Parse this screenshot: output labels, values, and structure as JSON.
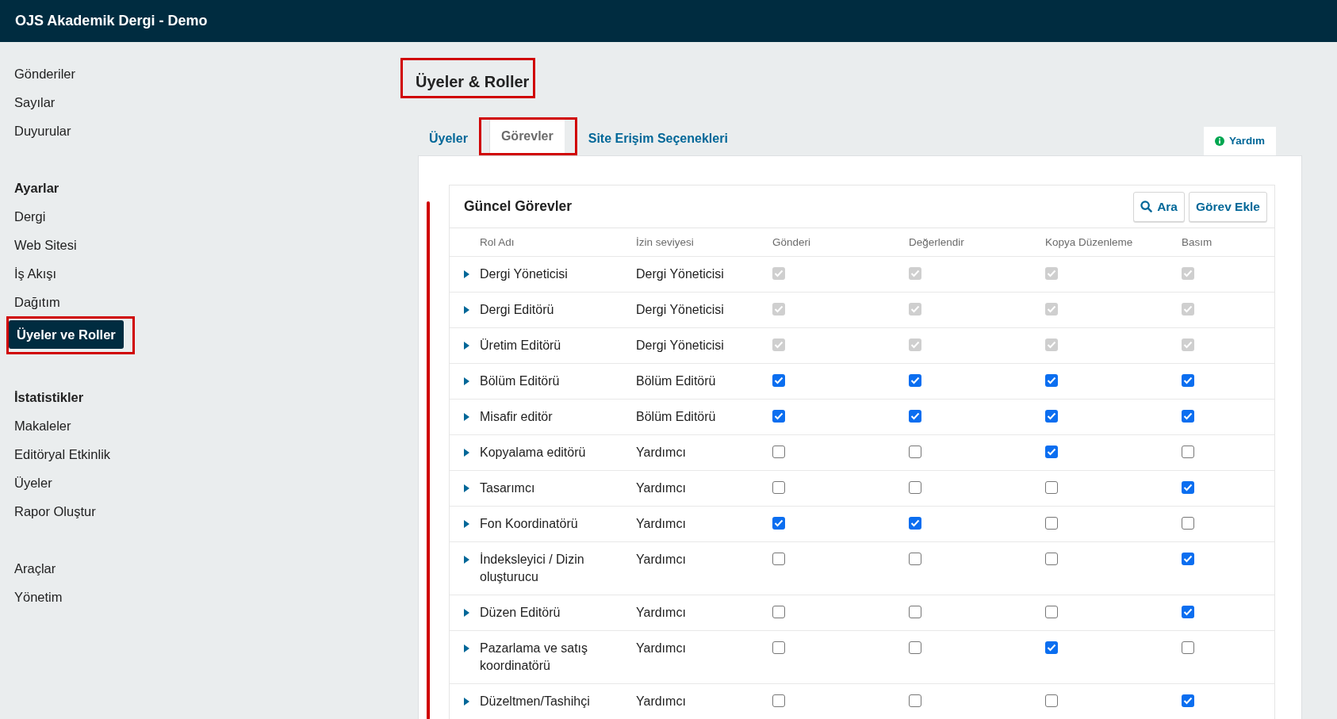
{
  "header": {
    "title": "OJS Akademik Dergi - Demo"
  },
  "sidebar": {
    "groups": [
      {
        "items": [
          {
            "label": "Gönderiler",
            "selected": false,
            "highlighted": false
          },
          {
            "label": "Sayılar",
            "selected": false,
            "highlighted": false
          },
          {
            "label": "Duyurular",
            "selected": false,
            "highlighted": false
          }
        ]
      },
      {
        "heading": "Ayarlar",
        "items": [
          {
            "label": "Dergi",
            "selected": false,
            "highlighted": false
          },
          {
            "label": "Web Sitesi",
            "selected": false,
            "highlighted": false
          },
          {
            "label": "İş Akışı",
            "selected": false,
            "highlighted": false
          },
          {
            "label": "Dağıtım",
            "selected": false,
            "highlighted": false
          },
          {
            "label": "Üyeler ve Roller",
            "selected": true,
            "highlighted": true
          }
        ]
      },
      {
        "heading": "İstatistikler",
        "items": [
          {
            "label": "Makaleler",
            "selected": false,
            "highlighted": false
          },
          {
            "label": "Editöryal Etkinlik",
            "selected": false,
            "highlighted": false
          },
          {
            "label": "Üyeler",
            "selected": false,
            "highlighted": false
          },
          {
            "label": "Rapor Oluştur",
            "selected": false,
            "highlighted": false
          }
        ]
      },
      {
        "items": [
          {
            "label": "Araçlar",
            "selected": false,
            "highlighted": false
          },
          {
            "label": "Yönetim",
            "selected": false,
            "highlighted": false
          }
        ]
      }
    ]
  },
  "page": {
    "title": "Üyeler & Roller",
    "title_highlighted": true,
    "annotation_bar": true
  },
  "tabs": [
    {
      "label": "Üyeler",
      "selected": false,
      "highlighted": false
    },
    {
      "label": "Görevler",
      "selected": true,
      "highlighted": true
    },
    {
      "label": "Site Erişim Seçenekleri",
      "selected": false,
      "highlighted": false
    }
  ],
  "help_button": "Yardım",
  "grid": {
    "title": "Güncel Görevler",
    "actions": [
      {
        "label": "Ara",
        "kind": "search"
      },
      {
        "label": "Görev Ekle",
        "kind": "plain"
      }
    ],
    "columns": [
      "Rol Adı",
      "İzin seviyesi",
      "Gönderi",
      "Değerlendir",
      "Kopya Düzenleme",
      "Basım"
    ],
    "rows": [
      {
        "name": "Dergi Yöneticisi",
        "level": "Dergi Yöneticisi",
        "stages": [
          {
            "checked": true,
            "disabled": true
          },
          {
            "checked": true,
            "disabled": true
          },
          {
            "checked": true,
            "disabled": true
          },
          {
            "checked": true,
            "disabled": true
          }
        ]
      },
      {
        "name": "Dergi Editörü",
        "level": "Dergi Yöneticisi",
        "stages": [
          {
            "checked": true,
            "disabled": true
          },
          {
            "checked": true,
            "disabled": true
          },
          {
            "checked": true,
            "disabled": true
          },
          {
            "checked": true,
            "disabled": true
          }
        ]
      },
      {
        "name": "Üretim Editörü",
        "level": "Dergi Yöneticisi",
        "stages": [
          {
            "checked": true,
            "disabled": true
          },
          {
            "checked": true,
            "disabled": true
          },
          {
            "checked": true,
            "disabled": true
          },
          {
            "checked": true,
            "disabled": true
          }
        ]
      },
      {
        "name": "Bölüm Editörü",
        "level": "Bölüm Editörü",
        "stages": [
          {
            "checked": true,
            "disabled": false
          },
          {
            "checked": true,
            "disabled": false
          },
          {
            "checked": true,
            "disabled": false
          },
          {
            "checked": true,
            "disabled": false
          }
        ]
      },
      {
        "name": "Misafir editör",
        "level": "Bölüm Editörü",
        "stages": [
          {
            "checked": true,
            "disabled": false
          },
          {
            "checked": true,
            "disabled": false
          },
          {
            "checked": true,
            "disabled": false
          },
          {
            "checked": true,
            "disabled": false
          }
        ]
      },
      {
        "name": "Kopyalama editörü",
        "level": "Yardımcı",
        "stages": [
          {
            "checked": false,
            "disabled": false
          },
          {
            "checked": false,
            "disabled": false
          },
          {
            "checked": true,
            "disabled": false
          },
          {
            "checked": false,
            "disabled": false
          }
        ]
      },
      {
        "name": "Tasarımcı",
        "level": "Yardımcı",
        "stages": [
          {
            "checked": false,
            "disabled": false
          },
          {
            "checked": false,
            "disabled": false
          },
          {
            "checked": false,
            "disabled": false
          },
          {
            "checked": true,
            "disabled": false
          }
        ]
      },
      {
        "name": "Fon Koordinatörü",
        "level": "Yardımcı",
        "stages": [
          {
            "checked": true,
            "disabled": false
          },
          {
            "checked": true,
            "disabled": false
          },
          {
            "checked": false,
            "disabled": false
          },
          {
            "checked": false,
            "disabled": false
          }
        ]
      },
      {
        "name": "İndeksleyici / Dizin oluşturucu",
        "level": "Yardımcı",
        "stages": [
          {
            "checked": false,
            "disabled": false
          },
          {
            "checked": false,
            "disabled": false
          },
          {
            "checked": false,
            "disabled": false
          },
          {
            "checked": true,
            "disabled": false
          }
        ]
      },
      {
        "name": "Düzen Editörü",
        "level": "Yardımcı",
        "stages": [
          {
            "checked": false,
            "disabled": false
          },
          {
            "checked": false,
            "disabled": false
          },
          {
            "checked": false,
            "disabled": false
          },
          {
            "checked": true,
            "disabled": false
          }
        ]
      },
      {
        "name": "Pazarlama ve satış koordinatörü",
        "level": "Yardımcı",
        "stages": [
          {
            "checked": false,
            "disabled": false
          },
          {
            "checked": false,
            "disabled": false
          },
          {
            "checked": true,
            "disabled": false
          },
          {
            "checked": false,
            "disabled": false
          }
        ]
      },
      {
        "name": "Düzeltmen/Tashihçi",
        "level": "Yardımcı",
        "stages": [
          {
            "checked": false,
            "disabled": false
          },
          {
            "checked": false,
            "disabled": false
          },
          {
            "checked": false,
            "disabled": false
          },
          {
            "checked": true,
            "disabled": false
          }
        ]
      }
    ]
  }
}
